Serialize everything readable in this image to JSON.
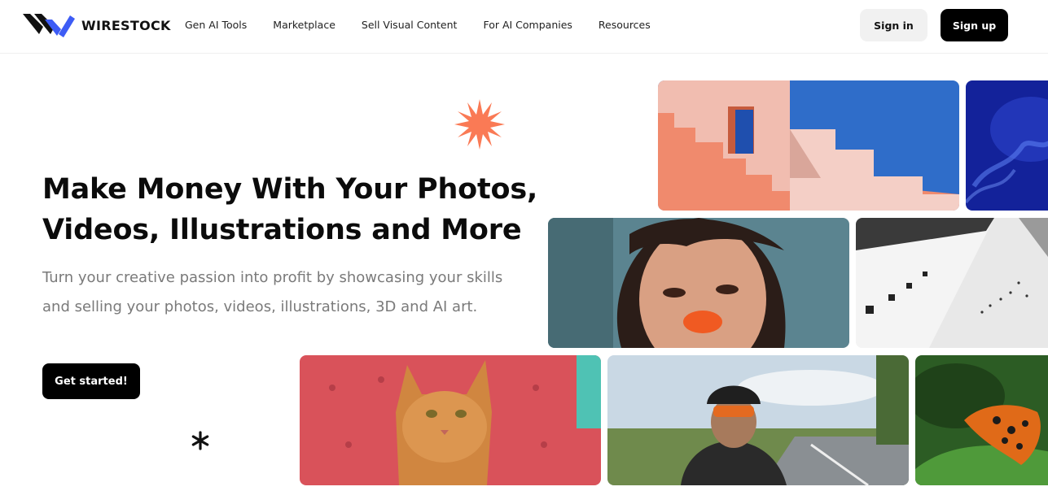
{
  "brand": {
    "name": "WIRESTOCK",
    "logo_colors": [
      "#111111",
      "#3d5cf5"
    ]
  },
  "nav": {
    "links": [
      "Gen AI Tools",
      "Marketplace",
      "Sell Visual Content",
      "For AI Companies",
      "Resources"
    ],
    "sign_in": "Sign in",
    "sign_up": "Sign up"
  },
  "hero": {
    "title_line1": "Make Money With Your Photos,",
    "title_line2": "Videos, Illustrations and More",
    "subtitle": "Turn your creative passion into profit by showcasing your skills and selling your photos, videos, illustrations, 3D and AI art.",
    "cta": "Get started!"
  },
  "decor": {
    "burst_color": "#fa7a55",
    "asterisk_color": "#111111"
  },
  "gallery": {
    "images": [
      "pink-stairs-architecture-photo",
      "blue-jellyfish-photo",
      "woman-portrait-orange-lips-photo",
      "bw-building-birds-photo",
      "orange-cat-red-sofa-photo",
      "cyclist-helmet-road-photo",
      "butterfly-on-leaf-photo"
    ]
  },
  "colors": {
    "accent": "#3d5cf5",
    "primary_button": "#000000",
    "secondary_button": "#f1f1f1"
  }
}
